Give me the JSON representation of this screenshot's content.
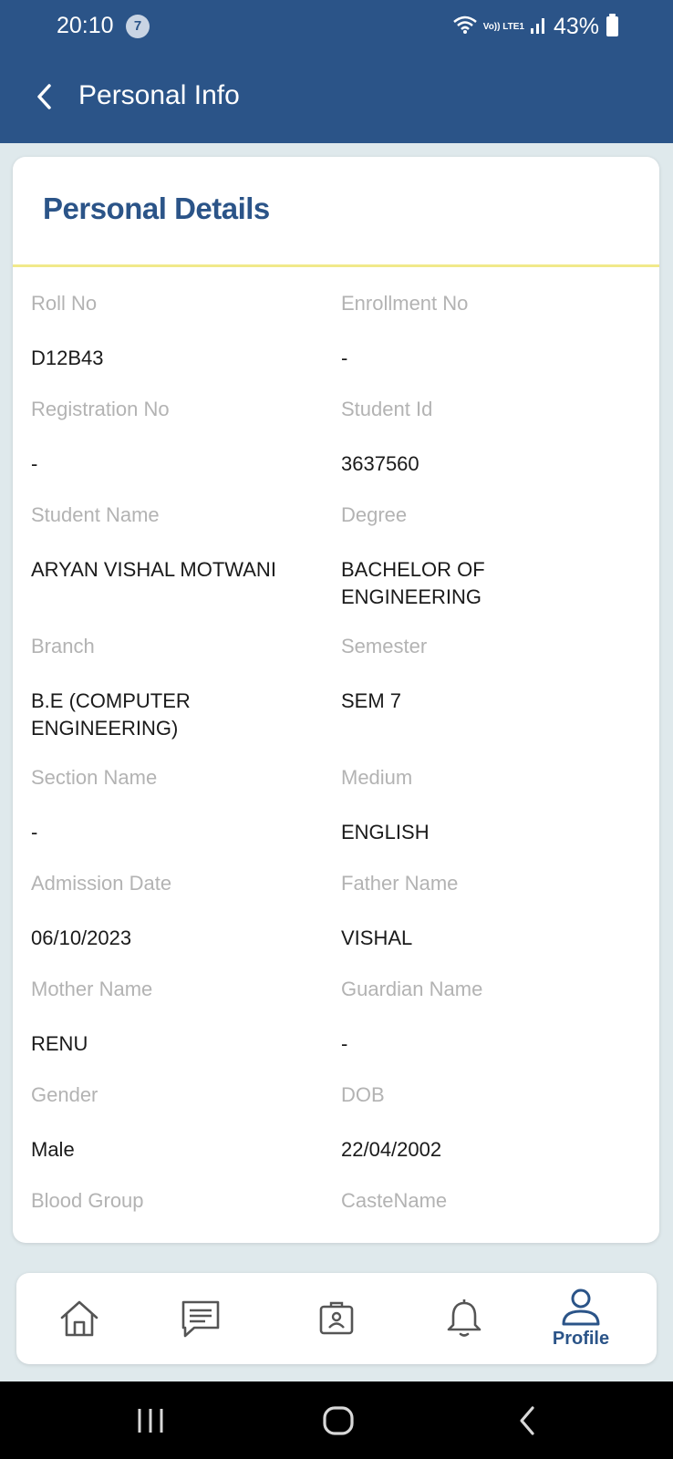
{
  "status_bar": {
    "time": "20:10",
    "notification_count": "7",
    "network_label": "Vo)) LTE1",
    "battery": "43%"
  },
  "header": {
    "title": "Personal Info"
  },
  "card": {
    "title": "Personal Details"
  },
  "fields": [
    {
      "label": "Roll No",
      "value": "D12B43"
    },
    {
      "label": "Enrollment No",
      "value": "-"
    },
    {
      "label": "Registration No",
      "value": "-"
    },
    {
      "label": "Student Id",
      "value": "3637560"
    },
    {
      "label": "Student Name",
      "value": "ARYAN VISHAL MOTWANI"
    },
    {
      "label": "Degree",
      "value": "BACHELOR OF ENGINEERING"
    },
    {
      "label": "Branch",
      "value": "B.E (COMPUTER ENGINEERING)"
    },
    {
      "label": "Semester",
      "value": "SEM 7"
    },
    {
      "label": "Section Name",
      "value": "-"
    },
    {
      "label": "Medium",
      "value": "ENGLISH"
    },
    {
      "label": "Admission Date",
      "value": "06/10/2023"
    },
    {
      "label": "Father Name",
      "value": "VISHAL"
    },
    {
      "label": "Mother Name",
      "value": "RENU"
    },
    {
      "label": "Guardian Name",
      "value": "-"
    },
    {
      "label": "Gender",
      "value": "Male"
    },
    {
      "label": "DOB",
      "value": "22/04/2002"
    },
    {
      "label": "Blood Group",
      "value": ""
    },
    {
      "label": "CasteName",
      "value": ""
    }
  ],
  "bottom_nav": {
    "items": [
      {
        "icon": "home-icon",
        "label": ""
      },
      {
        "icon": "message-icon",
        "label": ""
      },
      {
        "icon": "id-card-icon",
        "label": ""
      },
      {
        "icon": "bell-icon",
        "label": ""
      },
      {
        "icon": "profile-icon",
        "label": "Profile",
        "active": true
      }
    ]
  },
  "colors": {
    "primary": "#2b5488",
    "background": "#dfe9ec",
    "divider": "#f1e98a",
    "label": "#b3b3b3"
  }
}
